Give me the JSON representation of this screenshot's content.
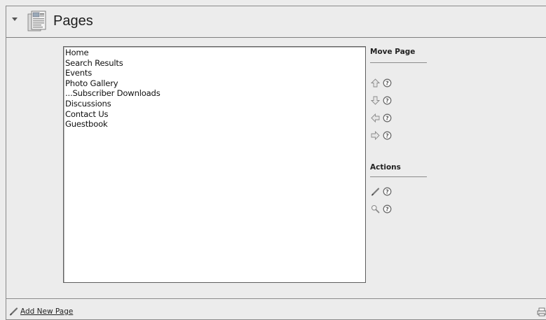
{
  "header": {
    "title": "Pages",
    "toggle_icon": "collapse-arrow-icon",
    "page_icon": "pages-icon"
  },
  "page_list": {
    "items": [
      "Home",
      "Search Results",
      "Events",
      "Photo Gallery",
      "...Subscriber Downloads",
      "Discussions",
      "Contact Us",
      "Guestbook"
    ]
  },
  "move_page": {
    "heading": "Move Page",
    "actions": [
      "move-up-icon",
      "move-down-icon",
      "move-left-icon",
      "move-right-icon"
    ]
  },
  "actions": {
    "heading": "Actions",
    "items": [
      "edit-pencil-icon",
      "view-magnifier-icon"
    ]
  },
  "footer": {
    "add_label": "Add New Page"
  }
}
